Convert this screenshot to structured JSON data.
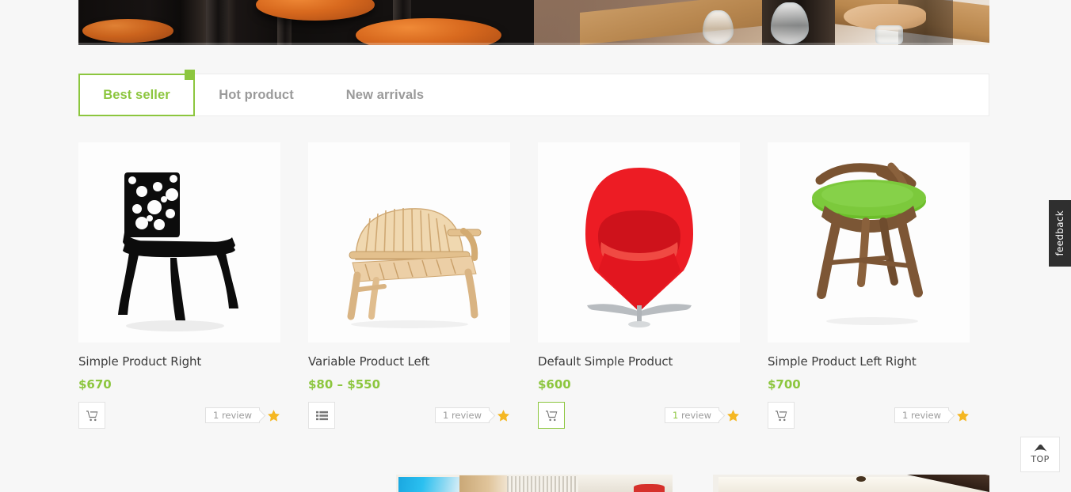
{
  "banner": {
    "name": "restaurant-interior-banner",
    "alt": "Dark bar interior with orange bar stools and a restaurant table set with wine glasses"
  },
  "tabs": {
    "items": [
      {
        "label": "Best seller",
        "active": true
      },
      {
        "label": "Hot product",
        "active": false
      },
      {
        "label": "New arrivals",
        "active": false
      }
    ]
  },
  "products": [
    {
      "title": "Simple Product Right",
      "price": "$670",
      "action_icon": "cart-icon",
      "action_highlight": false,
      "review_count": "1",
      "review_label": "review",
      "review_highlight": false,
      "image_alt": "Black chair with ornate filigree backrest"
    },
    {
      "title": "Variable Product Left",
      "price": "$80 – $550",
      "action_icon": "list-options-icon",
      "action_highlight": false,
      "review_count": "1",
      "review_label": "review",
      "review_highlight": false,
      "image_alt": "Rustic slatted wooden garden bench"
    },
    {
      "title": "Default Simple Product",
      "price": "$600",
      "action_icon": "cart-icon",
      "action_highlight": true,
      "review_count": "1",
      "review_label": "review",
      "review_highlight": true,
      "image_alt": "Red cone chair on a chrome cross base"
    },
    {
      "title": "Simple Product Left Right",
      "price": "$700",
      "action_icon": "cart-icon",
      "action_highlight": false,
      "review_count": "1",
      "review_label": "review",
      "review_highlight": false,
      "image_alt": "Walnut stool with green seat cushion and curved back rail"
    }
  ],
  "feedback": {
    "label": "feedback"
  },
  "scroll_top": {
    "label": "TOP",
    "icon": "triangle-up-icon"
  },
  "bottom_strips": [
    {
      "alt": "Bright interior with blue screen, wood panel and window blinds"
    },
    {
      "alt": "White ceiling with dark diagonal wooden beam"
    }
  ],
  "colors": {
    "accent_green": "#8cc63e",
    "page_background": "#f7f7f7",
    "card_background": "#ffffff",
    "title_text": "#3c3c3c",
    "muted_text": "#9a9a9a",
    "star_gold": "#f5b722",
    "feedback_background": "#2f2f2f"
  }
}
